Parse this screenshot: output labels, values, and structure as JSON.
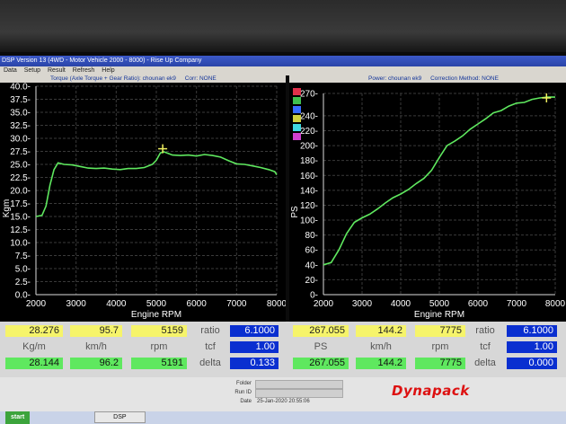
{
  "window": {
    "title": "DSP Version 13 (4WD - Motor Vehicle 2000 - 8000) - Rise Up Company",
    "menus": [
      "Data",
      "Setup",
      "Result",
      "Refresh",
      "Help"
    ]
  },
  "left_panel": {
    "header": "Torque (Axle Torque + Gear Ratio): chounan ek9",
    "header_right": "Corr: NONE"
  },
  "right_panel": {
    "header": "Power: chounan ek9",
    "header_right": "Correction Method: NONE"
  },
  "legend_colors": [
    "#e0304a",
    "#40c050",
    "#3a6cff",
    "#d0d040",
    "#40d8e0",
    "#d040d0",
    "#e07030"
  ],
  "chart_data": [
    {
      "type": "line",
      "xlabel": "Engine RPM",
      "ylabel": "Kgm",
      "xlim": [
        2000,
        8000
      ],
      "ylim": [
        0,
        40
      ],
      "xticks": [
        "2000",
        "3000",
        "4000",
        "5000",
        "6000",
        "7000",
        "8000"
      ],
      "yticks": [
        "0.0",
        "2.5",
        "5.0",
        "7.5",
        "10.0",
        "12.5",
        "15.0",
        "17.5",
        "20.0",
        "22.5",
        "25.0",
        "27.5",
        "30.0",
        "32.5",
        "35.0",
        "37.5",
        "40.0"
      ],
      "grid": true,
      "color": "#5fe85f",
      "marker": {
        "x": 5159,
        "y": 28.0
      },
      "series": [
        {
          "x": [
            2000,
            2150,
            2250,
            2350,
            2450,
            2550,
            2700,
            2900,
            3100,
            3300,
            3500,
            3700,
            3900,
            4100,
            4300,
            4500,
            4700,
            4900,
            5000,
            5100,
            5200,
            5400,
            5600,
            5800,
            6000,
            6200,
            6400,
            6600,
            6800,
            7000,
            7200,
            7400,
            7600,
            7800,
            7950,
            8000
          ],
          "y": [
            15.0,
            15.2,
            17.0,
            21.0,
            24.0,
            25.3,
            25.0,
            24.9,
            24.6,
            24.3,
            24.2,
            24.3,
            24.1,
            24.0,
            24.2,
            24.2,
            24.4,
            25.0,
            25.8,
            27.2,
            27.4,
            26.8,
            26.7,
            26.8,
            26.6,
            26.9,
            26.7,
            26.4,
            25.7,
            25.1,
            25.0,
            24.7,
            24.4,
            24.0,
            23.6,
            23.0
          ]
        }
      ]
    },
    {
      "type": "line",
      "xlabel": "Engine RPM",
      "ylabel": "PS",
      "xlim": [
        2000,
        8000
      ],
      "ylim": [
        0,
        270
      ],
      "xticks": [
        "2000",
        "3000",
        "4000",
        "5000",
        "6000",
        "7000",
        "8000"
      ],
      "yticks": [
        "0",
        "20",
        "40",
        "60",
        "80",
        "100",
        "120",
        "140",
        "160",
        "180",
        "200",
        "220",
        "240",
        "270"
      ],
      "grid": true,
      "color": "#5fe85f",
      "marker": {
        "x": 7775,
        "y": 264
      },
      "series": [
        {
          "x": [
            2000,
            2200,
            2400,
            2600,
            2800,
            3000,
            3200,
            3400,
            3600,
            3800,
            4000,
            4200,
            4400,
            4600,
            4800,
            5000,
            5200,
            5400,
            5600,
            5800,
            6000,
            6200,
            6400,
            6600,
            6800,
            7000,
            7200,
            7400,
            7600,
            7800,
            8000
          ],
          "y": [
            40,
            43,
            60,
            82,
            97,
            103,
            108,
            115,
            123,
            130,
            135,
            141,
            149,
            156,
            167,
            184,
            200,
            206,
            213,
            222,
            229,
            236,
            244,
            247,
            253,
            257,
            258,
            262,
            264,
            265,
            265
          ]
        }
      ]
    }
  ],
  "readouts": {
    "left": {
      "row1": [
        "28.276",
        "95.7",
        "5159"
      ],
      "units": [
        "Kg/m",
        "km/h",
        "rpm"
      ],
      "row3": [
        "28.144",
        "96.2",
        "5191"
      ],
      "ratio_label": "ratio",
      "ratio": "6.1000",
      "tcf_label": "tcf",
      "tcf": "1.00",
      "delta_label": "delta",
      "delta": "0.133"
    },
    "right": {
      "row1": [
        "267.055",
        "144.2",
        "7775"
      ],
      "units": [
        "PS",
        "km/h",
        "rpm"
      ],
      "row3": [
        "267.055",
        "144.2",
        "7775"
      ],
      "ratio_label": "ratio",
      "ratio": "6.1000",
      "tcf_label": "tcf",
      "tcf": "1.00",
      "delta_label": "delta",
      "delta": "0.000"
    }
  },
  "footer": {
    "folder_label": "Folder",
    "run_id_label": "Run ID",
    "date_label": "Date",
    "date": "25-Jan-2020 20:55:06",
    "brand": "Dynapack"
  },
  "taskbar": {
    "start": "start",
    "item": "DSP"
  }
}
